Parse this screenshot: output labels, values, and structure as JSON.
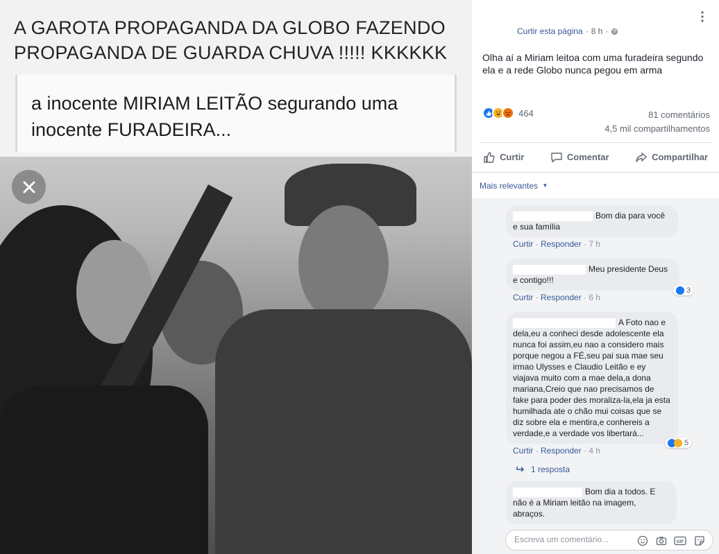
{
  "media": {
    "headline": "A GAROTA PROPAGANDA DA GLOBO FAZENDO PROPAGANDA DE GUARDA CHUVA !!!!! KKKKKK",
    "quote": "a inocente MIRIAM LEITÃO segurando uma inocente FURADEIRA...",
    "close_icon": "close-icon"
  },
  "post": {
    "like_page_label": "Curtir esta página",
    "separator": "·",
    "time": "8 h",
    "text": "Olha aí a Miriam leitoa com uma furadeira segundo ela e a rede Globo nunca pegou em arma",
    "reaction_count": "464",
    "comments_count": "81 comentários",
    "shares_count": "4,5 mil compartilhamentos"
  },
  "actions": {
    "like": "Curtir",
    "comment": "Comentar",
    "share": "Compartilhar"
  },
  "sort": {
    "label": "Mais relevantes"
  },
  "comments": [
    {
      "text": "Bom dia para você e sua família",
      "like": "Curtir",
      "reply": "Responder",
      "time": "7 h"
    },
    {
      "text": "Meu presidente Deus e contigo!!!",
      "like": "Curtir",
      "reply": "Responder",
      "time": "6 h",
      "reactions": "3"
    },
    {
      "text": "A Foto nao e dela,eu a conheci desde adolescente ela nunca foi assim,eu nao a considero mais porque negou a FÉ,seu pai sua mae seu irmao Ulysses e Claudio Leitão e ey viajava muito com a mae dela,a dona mariana,Creio que nao precisamos de fake para poder des moraliza-la,ela ja esta humilhada ate o chão mui coisas que se diz sobre ela e mentira,e conhereis a verdade,e a verdade vos libertará...",
      "like": "Curtir",
      "reply": "Responder",
      "time": "4 h",
      "reactions": "5"
    },
    {
      "text": "Bom dia a todos. E não é a Miriam leitão na imagem, abraços."
    }
  ],
  "reply_link": "1 resposta",
  "composer": {
    "placeholder": "Escreva um comentário..."
  },
  "colors": {
    "link": "#385898",
    "like_blue": "#1877f2",
    "haha_yellow": "#f7b125",
    "angry_orange": "#e9710f"
  }
}
